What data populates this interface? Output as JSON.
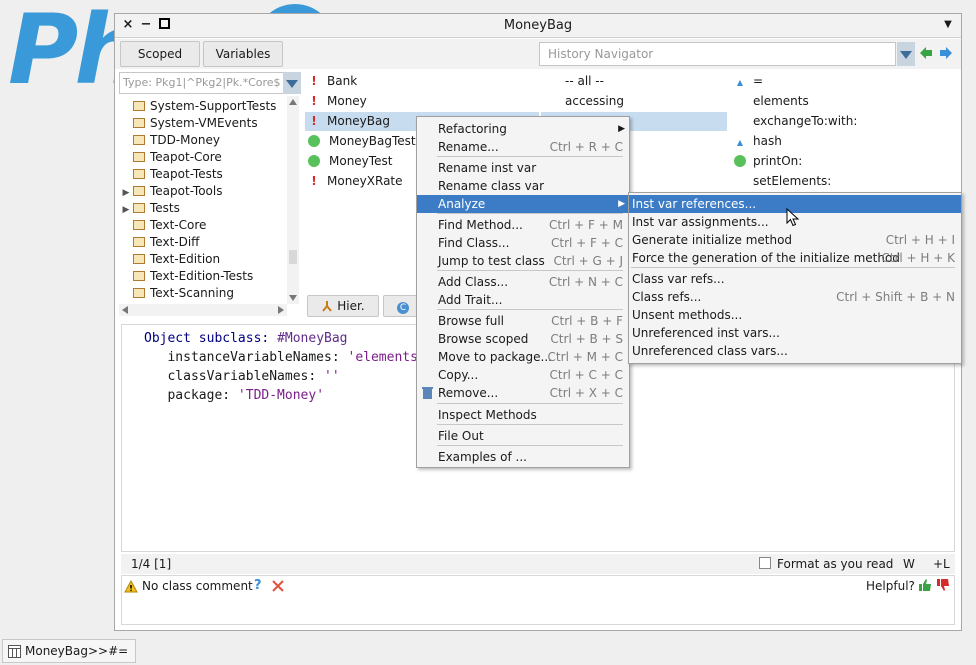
{
  "window": {
    "title": "MoneyBag",
    "close_symbol": "×",
    "minimize_symbol": "−",
    "menu_symbol": "▼"
  },
  "toolbar": {
    "scoped_label": "Scoped",
    "variables_label": "Variables",
    "history_placeholder": "History Navigator"
  },
  "packages": {
    "filter_placeholder": "Type: Pkg1|^Pkg2|Pk.*Core$",
    "items": [
      {
        "label": "System-SupportTests",
        "expandable": false
      },
      {
        "label": "System-VMEvents",
        "expandable": false
      },
      {
        "label": "TDD-Money",
        "expandable": false
      },
      {
        "label": "Teapot-Core",
        "expandable": false
      },
      {
        "label": "Teapot-Tests",
        "expandable": false
      },
      {
        "label": "Teapot-Tools",
        "expandable": true
      },
      {
        "label": "Tests",
        "expandable": true
      },
      {
        "label": "Text-Core",
        "expandable": false
      },
      {
        "label": "Text-Diff",
        "expandable": false
      },
      {
        "label": "Text-Edition",
        "expandable": false
      },
      {
        "label": "Text-Edition-Tests",
        "expandable": false
      },
      {
        "label": "Text-Scanning",
        "expandable": false
      }
    ]
  },
  "classes": {
    "items": [
      {
        "label": "Bank",
        "status": "error"
      },
      {
        "label": "Money",
        "status": "error"
      },
      {
        "label": "MoneyBag",
        "status": "error",
        "selected": true
      },
      {
        "label": "MoneyBagTest",
        "status": "pass"
      },
      {
        "label": "MoneyTest",
        "status": "pass"
      },
      {
        "label": "MoneyXRate",
        "status": "error"
      }
    ],
    "hier_tab": "Hier.",
    "class_tab": "C"
  },
  "protocols": {
    "items": [
      "-- all --",
      "accessing"
    ]
  },
  "methods": {
    "items": [
      {
        "label": "=",
        "marker": "override"
      },
      {
        "label": "elements",
        "marker": ""
      },
      {
        "label": "exchangeTo:with:",
        "marker": ""
      },
      {
        "label": "hash",
        "marker": "override"
      },
      {
        "label": "printOn:",
        "marker": "pass"
      },
      {
        "label": "setElements:",
        "marker": ""
      }
    ]
  },
  "code": {
    "line1_a": "Object subclass: ",
    "line1_b": "#MoneyBag",
    "line2_a": "   instanceVariableNames: ",
    "line2_b": "'elements",
    "line3_a": "   classVariableNames: ",
    "line3_b": "''",
    "line4_a": "   package: ",
    "line4_b": "'TDD-Money'"
  },
  "status": {
    "position": "1/4 [1]",
    "format_label": "Format as you read",
    "w_label": "W",
    "l_label": "+L"
  },
  "comment": {
    "text": "No class comment",
    "help": "?",
    "helpful": "Helpful?"
  },
  "context_menu": {
    "items": [
      {
        "label": "Refactoring",
        "shortcut": "",
        "submenu": true
      },
      {
        "label": "Rename...",
        "shortcut": "Ctrl + R + C"
      },
      {
        "label": "Rename inst var",
        "shortcut": ""
      },
      {
        "label": "Rename class var",
        "shortcut": ""
      },
      {
        "label": "Analyze",
        "shortcut": "",
        "submenu": true,
        "highlighted": true
      },
      {
        "label": "Find Method...",
        "shortcut": "Ctrl + F + M"
      },
      {
        "label": "Find Class...",
        "shortcut": "Ctrl + F + C"
      },
      {
        "label": "Jump to test class",
        "shortcut": "Ctrl + G + J"
      },
      {
        "label": "Add Class...",
        "shortcut": "Ctrl + N + C"
      },
      {
        "label": "Add Trait...",
        "shortcut": ""
      },
      {
        "label": "Browse full",
        "shortcut": "Ctrl + B + F"
      },
      {
        "label": "Browse scoped",
        "shortcut": "Ctrl + B + S"
      },
      {
        "label": "Move to package...",
        "shortcut": "Ctrl + M + C"
      },
      {
        "label": "Copy...",
        "shortcut": "Ctrl + C + C"
      },
      {
        "label": "Remove...",
        "shortcut": "Ctrl + X + C"
      },
      {
        "label": "Inspect Methods",
        "shortcut": ""
      },
      {
        "label": "File Out",
        "shortcut": ""
      },
      {
        "label": "Examples of ...",
        "shortcut": ""
      }
    ]
  },
  "analyze_menu": {
    "items": [
      {
        "label": "Inst var references...",
        "shortcut": "",
        "highlighted": true
      },
      {
        "label": "Inst var assignments...",
        "shortcut": ""
      },
      {
        "label": "Generate initialize method",
        "shortcut": "Ctrl + H + I"
      },
      {
        "label": "Force the generation of the initialize method",
        "shortcut": "Ctrl + H + K"
      },
      {
        "label": "Class var refs...",
        "shortcut": ""
      },
      {
        "label": "Class refs...",
        "shortcut": "Ctrl + Shift + B + N"
      },
      {
        "label": "Unsent methods...",
        "shortcut": ""
      },
      {
        "label": "Unreferenced inst vars...",
        "shortcut": ""
      },
      {
        "label": "Unreferenced class vars...",
        "shortcut": ""
      }
    ]
  },
  "taskbar": {
    "item_label": "MoneyBag>>#="
  },
  "background": {
    "logo_text": "Ph"
  },
  "colors": {
    "accent": "#3c7cc6",
    "selection": "#c8dcf0",
    "pass": "#58c15b",
    "error": "#d62b2b"
  }
}
